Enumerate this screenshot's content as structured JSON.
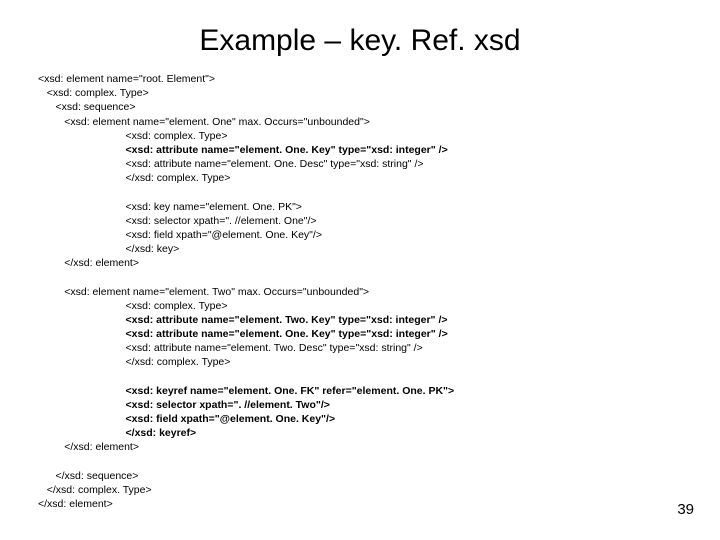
{
  "title": "Example – key. Ref. xsd",
  "page_number": "39",
  "lines": [
    {
      "text": "<xsd: element name=\"root. Element\">",
      "bold": false,
      "indent": 0
    },
    {
      "text": "<xsd: complex. Type>",
      "bold": false,
      "indent": 1
    },
    {
      "text": "<xsd: sequence>",
      "bold": false,
      "indent": 2
    },
    {
      "text": "<xsd: element name=\"element. One\" max. Occurs=\"unbounded\">",
      "bold": false,
      "indent": 3
    },
    {
      "text": "<xsd: complex. Type>",
      "bold": false,
      "indent": 10
    },
    {
      "text": "<xsd: attribute name=\"element. One. Key\" type=\"xsd: integer\" />",
      "bold": true,
      "indent": 10
    },
    {
      "text": "<xsd: attribute name=\"element. One. Desc\" type=\"xsd: string\" />",
      "bold": false,
      "indent": 10
    },
    {
      "text": "</xsd: complex. Type>",
      "bold": false,
      "indent": 10
    },
    {
      "text": "",
      "bold": false,
      "indent": 0
    },
    {
      "text": "<xsd: key name=\"element. One. PK\">",
      "bold": false,
      "indent": 10
    },
    {
      "text": "<xsd: selector xpath=\". //element. One\"/>",
      "bold": false,
      "indent": 10
    },
    {
      "text": "<xsd: field xpath=\"@element. One. Key\"/>",
      "bold": false,
      "indent": 10
    },
    {
      "text": "</xsd: key>",
      "bold": false,
      "indent": 10
    },
    {
      "text": "</xsd: element>",
      "bold": false,
      "indent": 3
    },
    {
      "text": "",
      "bold": false,
      "indent": 0
    },
    {
      "text": "<xsd: element name=\"element. Two\" max. Occurs=\"unbounded\">",
      "bold": false,
      "indent": 3
    },
    {
      "text": "<xsd: complex. Type>",
      "bold": false,
      "indent": 10
    },
    {
      "text": "<xsd: attribute name=\"element. Two. Key\" type=\"xsd: integer\" />",
      "bold": true,
      "indent": 10
    },
    {
      "text": "<xsd: attribute name=\"element. One. Key\" type=\"xsd: integer\" />",
      "bold": true,
      "indent": 10
    },
    {
      "text": "<xsd: attribute name=\"element. Two. Desc\" type=\"xsd: string\" />",
      "bold": false,
      "indent": 10
    },
    {
      "text": "</xsd: complex. Type>",
      "bold": false,
      "indent": 10
    },
    {
      "text": "",
      "bold": false,
      "indent": 0
    },
    {
      "text": "<xsd: keyref name=\"element. One. FK\" refer=\"element. One. PK\">",
      "bold": true,
      "indent": 10
    },
    {
      "text": "<xsd: selector xpath=\". //element. Two\"/>",
      "bold": true,
      "indent": 10
    },
    {
      "text": "<xsd: field xpath=\"@element. One. Key\"/>",
      "bold": true,
      "indent": 10
    },
    {
      "text": "</xsd: keyref>",
      "bold": true,
      "indent": 10
    },
    {
      "text": "</xsd: element>",
      "bold": false,
      "indent": 3
    },
    {
      "text": "",
      "bold": false,
      "indent": 0
    },
    {
      "text": "</xsd: sequence>",
      "bold": false,
      "indent": 2
    },
    {
      "text": "</xsd: complex. Type>",
      "bold": false,
      "indent": 1
    },
    {
      "text": "</xsd: element>",
      "bold": false,
      "indent": 0
    }
  ]
}
